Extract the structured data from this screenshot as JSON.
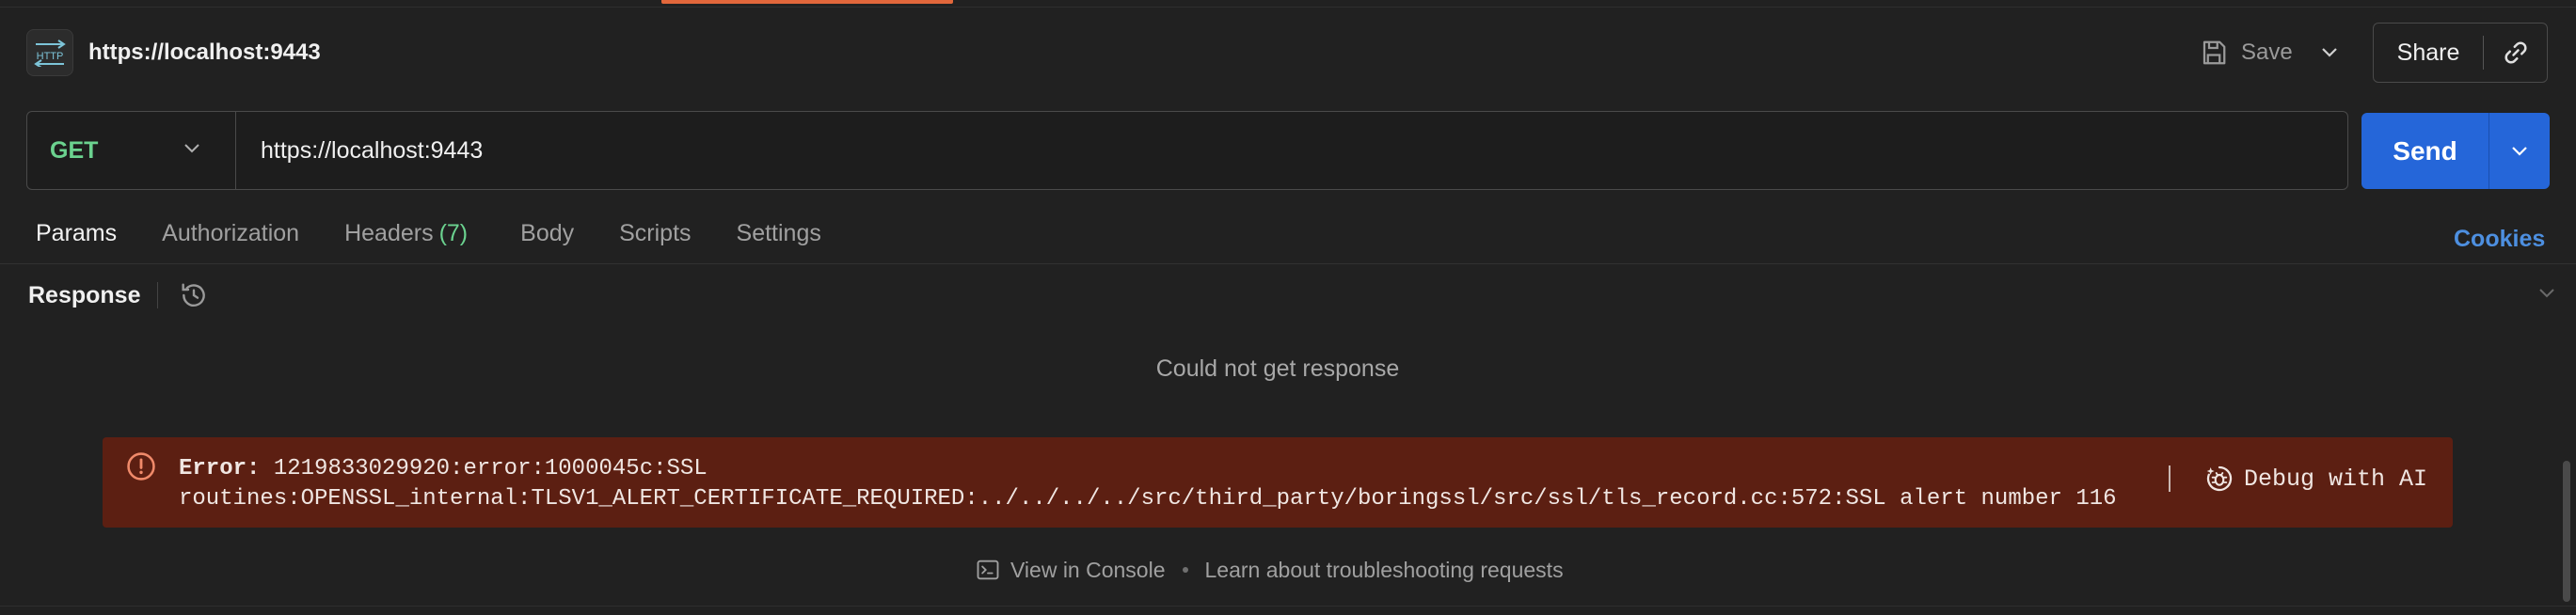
{
  "header": {
    "badge_text": "HTTP",
    "title": "https://localhost:9443",
    "save_label": "Save",
    "share_label": "Share"
  },
  "request": {
    "method": "GET",
    "url": "https://localhost:9443",
    "send_label": "Send"
  },
  "tabs": [
    {
      "label": "Params",
      "active": true
    },
    {
      "label": "Authorization"
    },
    {
      "label": "Headers",
      "count": "(7)"
    },
    {
      "label": "Body"
    },
    {
      "label": "Scripts"
    },
    {
      "label": "Settings"
    }
  ],
  "cookies_label": "Cookies",
  "response": {
    "label": "Response",
    "status_message": "Could not get response",
    "error": {
      "prefix": "Error:",
      "line1": "1219833029920:error:1000045c:SSL",
      "line2": "routines:OPENSSL_internal:TLSV1_ALERT_CERTIFICATE_REQUIRED:../../../../src/third_party/boringssl/src/ssl/tls_record.cc:572:SSL alert number 116"
    },
    "debug_label": "Debug with AI",
    "view_console_label": "View in Console",
    "troubleshoot_label": "Learn about troubleshooting requests"
  },
  "colors": {
    "accent": "#e2673b",
    "send_button": "#2566d9",
    "method_get": "#6bd28f",
    "cookies_link": "#4d8fe0",
    "error_background": "#5c1f12"
  },
  "icons": [
    "http-icon",
    "save-icon",
    "chevron-down-icon",
    "link-icon",
    "history-icon",
    "error-icon",
    "debug-ai-icon",
    "console-icon"
  ]
}
